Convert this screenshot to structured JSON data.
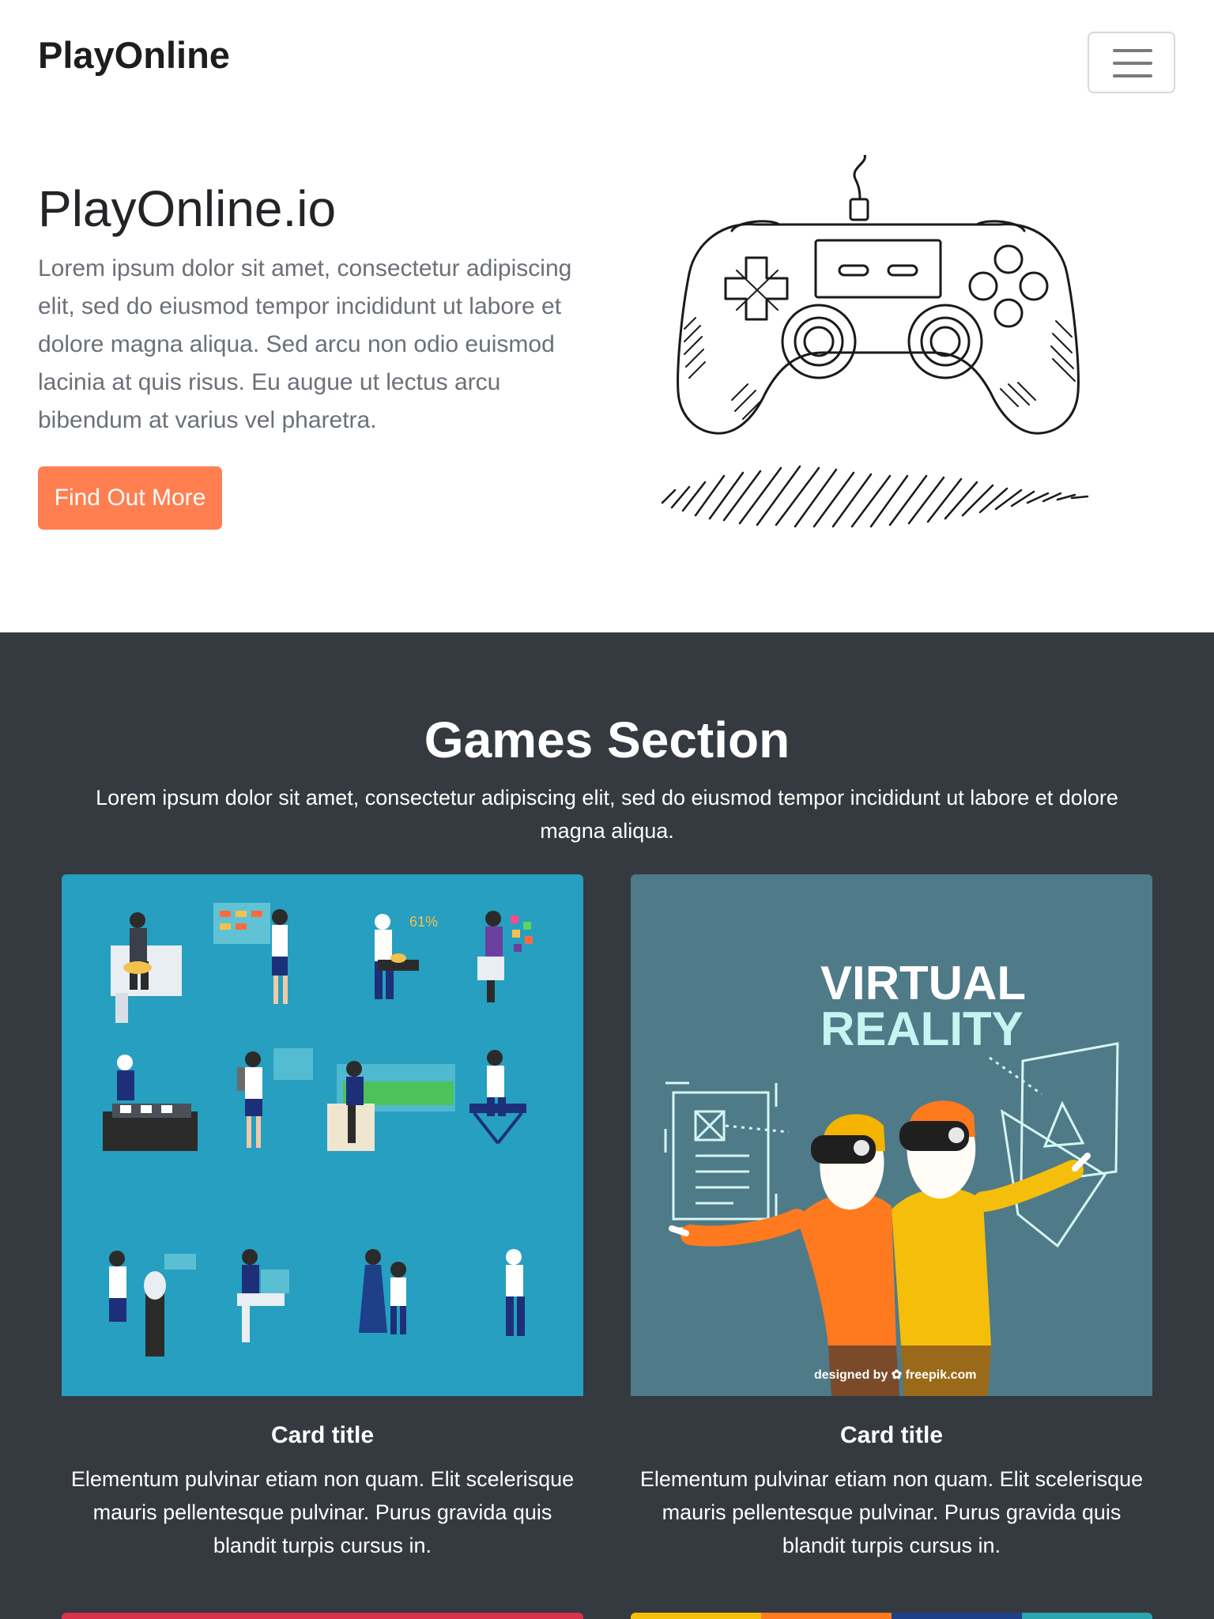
{
  "navbar": {
    "brand": "PlayOnline",
    "menu_icon": "hamburger-icon"
  },
  "hero": {
    "title": "PlayOnline.io",
    "text": "Lorem ipsum dolor sit amet, consectetur adipiscing elit, sed do eiusmod tempor incididunt ut labore et dolore magna aliqua. Sed arcu non odio euismod lacinia at quis risus. Eu augue ut lectus arcu bibendum at varius vel pharetra.",
    "button_label": "Find Out More",
    "button_color": "#ff7f50",
    "illustration": "gamepad-illustration"
  },
  "games": {
    "title": "Games Section",
    "description": "Lorem ipsum dolor sit amet, consectetur adipiscing elit, sed do eiusmod tempor incididunt ut labore et dolore magna aliqua.",
    "background": "#343a40",
    "cards": [
      {
        "image": "isometric-people-illustration",
        "title": "Card title",
        "text": "Elementum pulvinar etiam non quam. Elit scelerisque mauris pellentesque pulvinar. Purus gravida quis blandit turpis cursus in."
      },
      {
        "image": "virtual-reality-illustration",
        "image_heading_line1": "VIRTUAL",
        "image_heading_line2": "REALITY",
        "image_credit": "designed by ✿ freepik.com",
        "title": "Card title",
        "text": "Elementum pulvinar etiam non quam. Elit scelerisque mauris pellentesque pulvinar. Purus gravida quis blandit turpis cursus in."
      }
    ]
  }
}
